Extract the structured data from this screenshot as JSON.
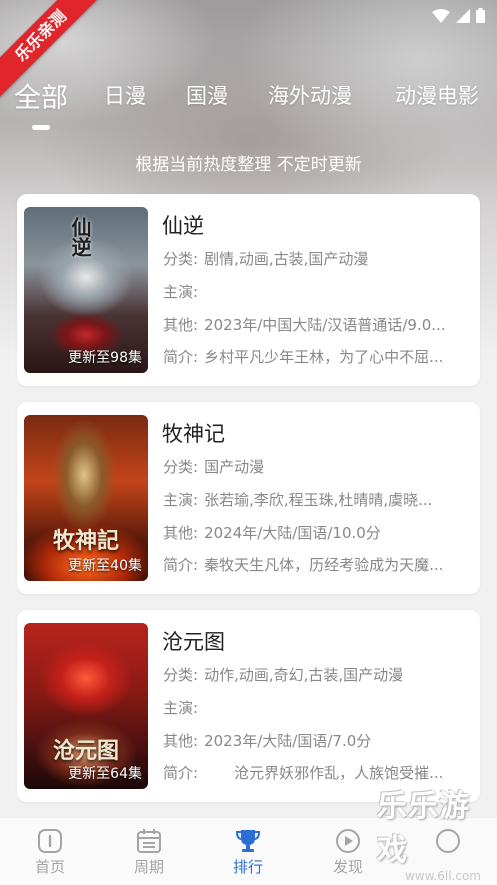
{
  "ribbon": {
    "text": "乐乐亲测"
  },
  "tabs": [
    {
      "label": "全部",
      "active": true
    },
    {
      "label": "日漫",
      "active": false
    },
    {
      "label": "国漫",
      "active": false
    },
    {
      "label": "海外动漫",
      "active": false
    },
    {
      "label": "动漫电影",
      "active": false
    }
  ],
  "subtitle": "根据当前热度整理 不定时更新",
  "cards": [
    {
      "title": "仙逆",
      "badge": "更新至98集",
      "poster_title": "仙逆",
      "category_key": "分类:",
      "category": "剧情,动画,古装,国产动漫",
      "cast_key": "主演:",
      "cast": "",
      "other_key": "其他:",
      "other": "2023年/中国大陆/汉语普通话/9.0...",
      "intro_key": "简介:",
      "intro": "乡村平凡少年王林，为了心中不屈..."
    },
    {
      "title": "牧神记",
      "badge": "更新至40集",
      "poster_title": "牧神記",
      "category_key": "分类:",
      "category": "国产动漫",
      "cast_key": "主演:",
      "cast": "张若瑜,李欣,程玉珠,杜晴晴,虞晓...",
      "other_key": "其他:",
      "other": "2024年/大陆/国语/10.0分",
      "intro_key": "简介:",
      "intro": "秦牧天生凡体，历经考验成为天魔..."
    },
    {
      "title": "沧元图",
      "badge": "更新至64集",
      "poster_title": "沧元图",
      "category_key": "分类:",
      "category": "动作,动画,奇幻,古装,国产动漫",
      "cast_key": "主演:",
      "cast": "",
      "other_key": "其他:",
      "other": "2023年/大陆/国语/7.0分",
      "intro_key": "简介:",
      "intro": "　　沧元界妖邪作乱，人族饱受摧..."
    }
  ],
  "bottom_nav": [
    {
      "label": "首页",
      "icon": "home-icon",
      "active": false
    },
    {
      "label": "周期",
      "icon": "calendar-icon",
      "active": false
    },
    {
      "label": "排行",
      "icon": "trophy-icon",
      "active": true
    },
    {
      "label": "发现",
      "icon": "play-circle-icon",
      "active": false
    },
    {
      "label": "",
      "icon": "profile-icon",
      "active": false
    }
  ],
  "watermark": {
    "text": "乐乐游戏",
    "url": "www.6ll.com"
  },
  "colors": {
    "accent": "#2b6fd6",
    "ribbon": "#e0262a"
  }
}
